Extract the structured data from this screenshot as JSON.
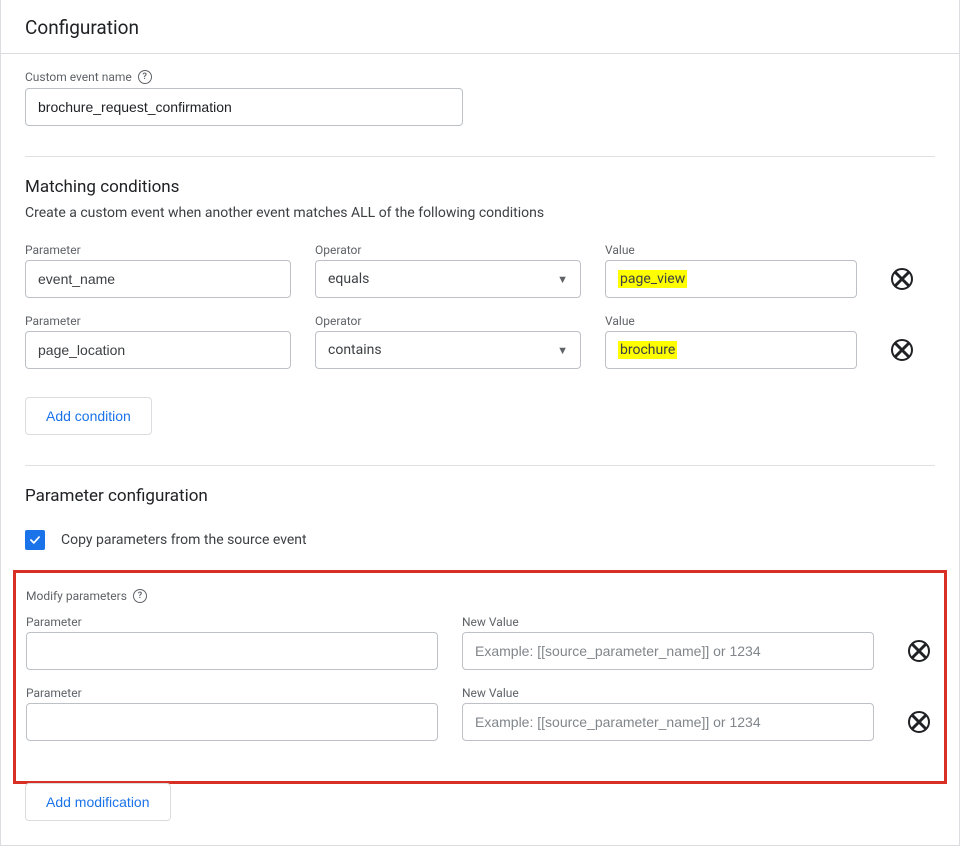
{
  "title": "Configuration",
  "customEvent": {
    "label": "Custom event name",
    "value": "brochure_request_confirmation"
  },
  "matching": {
    "title": "Matching conditions",
    "subtitle": "Create a custom event when another event matches ALL of the following conditions",
    "labels": {
      "parameter": "Parameter",
      "operator": "Operator",
      "value": "Value"
    },
    "rows": [
      {
        "parameter": "event_name",
        "operator": "equals",
        "value": "page_view"
      },
      {
        "parameter": "page_location",
        "operator": "contains",
        "value": "brochure"
      }
    ],
    "addConditionLabel": "Add condition"
  },
  "paramConfig": {
    "title": "Parameter configuration",
    "copyLabel": "Copy parameters from the source event",
    "modifyLabel": "Modify parameters",
    "labels": {
      "parameter": "Parameter",
      "newValue": "New Value"
    },
    "placeholder": "Example: [[source_parameter_name]] or 1234",
    "rows": [
      {
        "parameter": "",
        "value": ""
      },
      {
        "parameter": "",
        "value": ""
      }
    ],
    "addModificationLabel": "Add modification"
  }
}
